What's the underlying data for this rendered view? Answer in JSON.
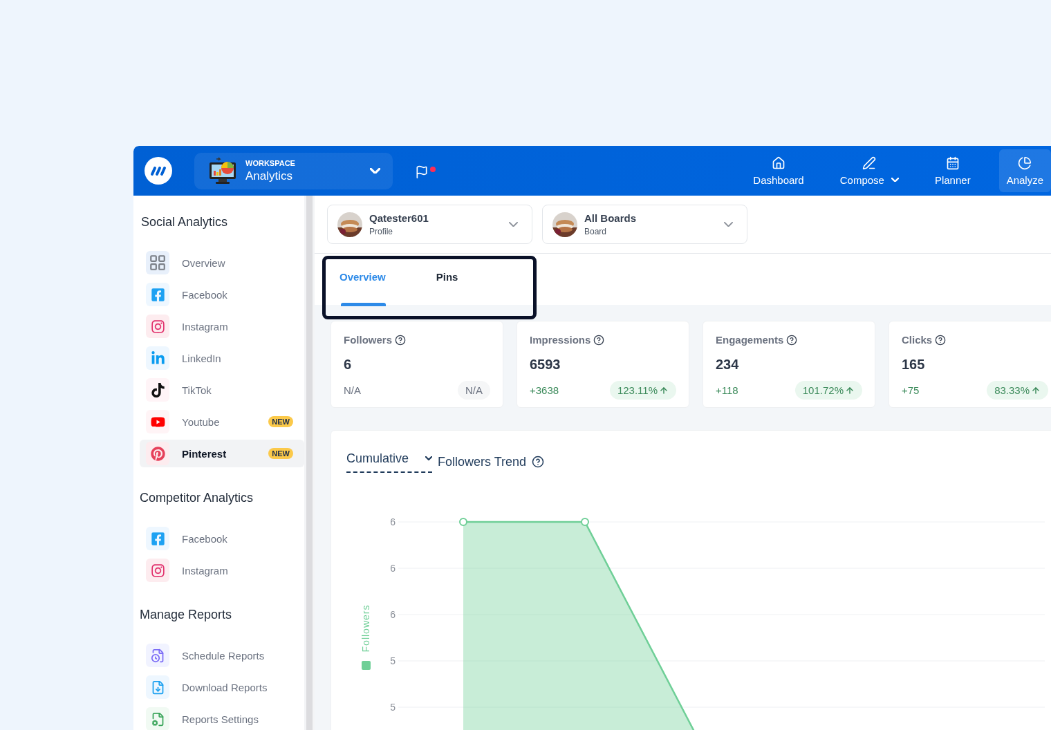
{
  "topbar": {
    "workspace": {
      "caption": "WORKSPACE",
      "name": "Analytics"
    },
    "flag": {
      "notification_dot": true
    },
    "nav": [
      {
        "label": "Dashboard",
        "kind": "home",
        "dropdown": false,
        "selected": false
      },
      {
        "label": "Compose",
        "kind": "pen",
        "dropdown": true,
        "selected": false
      },
      {
        "label": "Planner",
        "kind": "calendar",
        "dropdown": false,
        "selected": false
      },
      {
        "label": "Analyze",
        "kind": "pie",
        "dropdown": false,
        "selected": true
      }
    ]
  },
  "sidebar": {
    "sections": [
      {
        "title": "Social Analytics",
        "items": [
          {
            "label": "Overview",
            "kind": "grid",
            "selected": false
          },
          {
            "label": "Facebook",
            "kind": "facebook",
            "selected": false
          },
          {
            "label": "Instagram",
            "kind": "instagram",
            "selected": false
          },
          {
            "label": "LinkedIn",
            "kind": "linkedin",
            "selected": false
          },
          {
            "label": "TikTok",
            "kind": "tiktok",
            "selected": false
          },
          {
            "label": "Youtube",
            "kind": "youtube",
            "badge": "NEW",
            "selected": false
          },
          {
            "label": "Pinterest",
            "kind": "pinterest",
            "badge": "NEW",
            "selected": true
          }
        ]
      },
      {
        "title": "Competitor Analytics",
        "items": [
          {
            "label": "Facebook",
            "kind": "facebook",
            "selected": false
          },
          {
            "label": "Instagram",
            "kind": "instagram",
            "selected": false
          }
        ]
      },
      {
        "title": "Manage Reports",
        "items": [
          {
            "label": "Schedule Reports",
            "kind": "schedule",
            "selected": false
          },
          {
            "label": "Download Reports",
            "kind": "download",
            "selected": false
          },
          {
            "label": "Reports Settings",
            "kind": "settings",
            "selected": false
          }
        ]
      }
    ]
  },
  "selectors": [
    {
      "name": "Qatester601",
      "type": "Profile"
    },
    {
      "name": "All Boards",
      "type": "Board"
    }
  ],
  "tabs": {
    "highlighted": true,
    "items": [
      {
        "label": "Overview",
        "selected": true
      },
      {
        "label": "Pins",
        "selected": false
      }
    ]
  },
  "stats": [
    {
      "title": "Followers",
      "value": "6",
      "change": "N/A",
      "percent": "N/A",
      "rising": false
    },
    {
      "title": "Impressions",
      "value": "6593",
      "change": "+3638",
      "percent": "123.11%",
      "rising": true
    },
    {
      "title": "Engagements",
      "value": "234",
      "change": "+118",
      "percent": "101.72%",
      "rising": true
    },
    {
      "title": "Clicks",
      "value": "165",
      "change": "+75",
      "percent": "83.33%",
      "rising": true
    }
  ],
  "chart": {
    "mode": "Cumulative",
    "title": "Followers Trend",
    "legend": "Followers",
    "axis_labels": [
      "6",
      "6",
      "6",
      "5",
      "5"
    ]
  }
}
